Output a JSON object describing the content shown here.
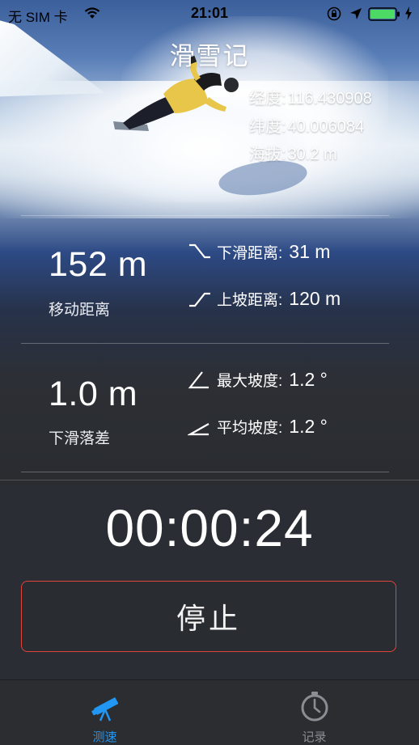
{
  "status_bar": {
    "carrier": "无 SIM 卡",
    "time": "21:01"
  },
  "header": {
    "title": "滑雪记"
  },
  "location": [
    {
      "label": "经度:",
      "value": "116.430908"
    },
    {
      "label": "纬度:",
      "value": "40.006084"
    },
    {
      "label": "海拔:",
      "value": "30.2 m"
    }
  ],
  "stats": {
    "distance": {
      "value": "152 m",
      "label": "移动距离"
    },
    "drop": {
      "value": "1.0 m",
      "label": "下滑落差"
    },
    "downhill": {
      "label": "下滑距离:",
      "value": "31 m"
    },
    "uphill": {
      "label": "上坡距离:",
      "value": "120 m"
    },
    "max_slope": {
      "label": "最大坡度:",
      "value": "1.2 °"
    },
    "avg_slope": {
      "label": "平均坡度:",
      "value": "1.2 °"
    }
  },
  "timer": "00:00:24",
  "stop_button": "停止",
  "tabs": [
    {
      "label": "测速",
      "icon": "telescope-icon",
      "active": true
    },
    {
      "label": "记录",
      "icon": "stopwatch-icon",
      "active": false
    }
  ],
  "colors": {
    "accent": "#2196f3",
    "stop_border": "#e0443a",
    "inactive_tab": "#8a8d93"
  }
}
